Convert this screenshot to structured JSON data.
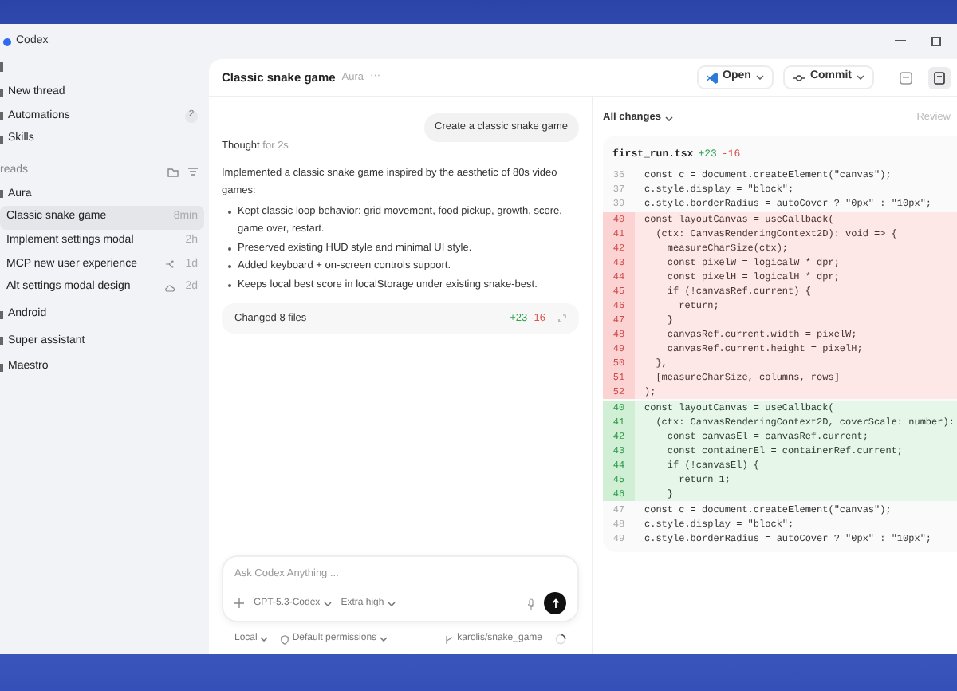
{
  "window": {
    "title": "Codex"
  },
  "sidebar": {
    "nav": [
      {
        "label": "New thread"
      },
      {
        "label": "Automations",
        "badge": "2"
      },
      {
        "label": "Skills"
      }
    ],
    "section_title": "reads",
    "projects": [
      {
        "name": "Aura",
        "threads": [
          {
            "title": "Classic snake game",
            "time": "8min",
            "selected": true
          },
          {
            "title": "Implement settings modal",
            "time": "2h",
            "selected": false
          },
          {
            "title": "MCP new user experience",
            "time": "1d",
            "selected": false,
            "kind": "branch"
          },
          {
            "title": "Alt settings modal design",
            "time": "2d",
            "selected": false,
            "kind": "cloud"
          }
        ]
      },
      {
        "name": "Android"
      },
      {
        "name": "Super assistant"
      },
      {
        "name": "Maestro"
      }
    ]
  },
  "header": {
    "title": "Classic snake game",
    "project": "Aura",
    "more": "···"
  },
  "toolbar": {
    "buttons": [
      {
        "label": "Open",
        "kind": "editor"
      },
      {
        "label": "Commit",
        "kind": "commit"
      }
    ]
  },
  "chat": {
    "user_message": "Create a classic snake game",
    "thought": {
      "label": "Thought",
      "duration": "for 2s"
    },
    "response": "Implemented a classic snake game inspired by the aesthetic of 80s video games:",
    "bullets": [
      "Kept classic loop behavior: grid movement, food pickup, growth, score, game over, restart.",
      "Preserved existing HUD style and minimal UI style.",
      "Added keyboard + on-screen controls support.",
      "Keeps local best score in localStorage under existing snake-best."
    ],
    "changes": {
      "label": "Changed 8 files",
      "added": "+23",
      "removed": "-16"
    }
  },
  "composer": {
    "placeholder": "Ask Codex Anything ...",
    "model": "GPT-5.3-Codex",
    "effort": "Extra high"
  },
  "footer": {
    "environment": "Local",
    "permissions": "Default permissions",
    "branch": "karolis/snake_game"
  },
  "diff": {
    "filter": "All changes",
    "review": {
      "label": "Review",
      "disabled": true
    },
    "file": {
      "name": "first_run.tsx",
      "added": "+23",
      "removed": "-16"
    },
    "lines": [
      {
        "kind": "context",
        "number": "36",
        "text": "const c = document.createElement(\"canvas\");"
      },
      {
        "kind": "context",
        "number": "37",
        "text": "c.style.display = \"block\";"
      },
      {
        "kind": "context",
        "number": "39",
        "text": "c.style.borderRadius = autoCover ? \"0px\" : \"10px\";"
      },
      {
        "kind": "removed",
        "number": "40",
        "text": "const layoutCanvas = useCallback("
      },
      {
        "kind": "removed",
        "number": "41",
        "text": "  (ctx: CanvasRenderingContext2D): void => {"
      },
      {
        "kind": "removed",
        "number": "42",
        "text": "    measureCharSize(ctx);"
      },
      {
        "kind": "removed",
        "number": "43",
        "text": "    const pixelW = logicalW * dpr;"
      },
      {
        "kind": "removed",
        "number": "44",
        "text": "    const pixelH = logicalH * dpr;"
      },
      {
        "kind": "removed",
        "number": "45",
        "text": "    if (!canvasRef.current) {"
      },
      {
        "kind": "removed",
        "number": "46",
        "text": "      return;"
      },
      {
        "kind": "removed",
        "number": "47",
        "text": "    }"
      },
      {
        "kind": "removed",
        "number": "48",
        "text": "    canvasRef.current.width = pixelW;"
      },
      {
        "kind": "removed",
        "number": "49",
        "text": "    canvasRef.current.height = pixelH;"
      },
      {
        "kind": "removed",
        "number": "50",
        "text": "  },"
      },
      {
        "kind": "removed",
        "number": "51",
        "text": "  [measureCharSize, columns, rows]"
      },
      {
        "kind": "removed",
        "number": "52",
        "text": ");"
      },
      {
        "kind": "added",
        "number": "40",
        "text": "const layoutCanvas = useCallback("
      },
      {
        "kind": "added",
        "number": "41",
        "text": "  (ctx: CanvasRenderingContext2D, coverScale: number):"
      },
      {
        "kind": "added",
        "number": "42",
        "text": "    const canvasEl = canvasRef.current;"
      },
      {
        "kind": "added",
        "number": "43",
        "text": "    const containerEl = containerRef.current;"
      },
      {
        "kind": "added",
        "number": "44",
        "text": "    if (!canvasEl) {"
      },
      {
        "kind": "added",
        "number": "45",
        "text": "      return 1;"
      },
      {
        "kind": "added",
        "number": "46",
        "text": "    }"
      },
      {
        "kind": "context",
        "number": "47",
        "text": "const c = document.createElement(\"canvas\");"
      },
      {
        "kind": "context",
        "number": "48",
        "text": "c.style.display = \"block\";"
      },
      {
        "kind": "context",
        "number": "49",
        "text": "c.style.borderRadius = autoCover ? \"0px\" : \"10px\";"
      }
    ]
  }
}
